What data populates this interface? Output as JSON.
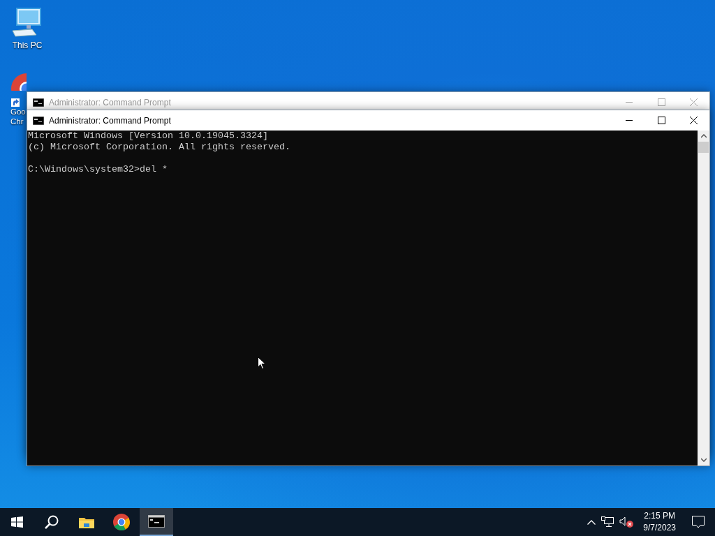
{
  "desktop": {
    "icons": [
      {
        "kind": "computer",
        "label_lines": [
          "This PC"
        ]
      },
      {
        "kind": "chrome",
        "label_lines": [
          "Goo",
          "Chr"
        ]
      }
    ]
  },
  "windows": [
    {
      "title": "Administrator: Command Prompt",
      "active": false
    },
    {
      "title": "Administrator: Command Prompt",
      "active": true,
      "console": {
        "lines": [
          "Microsoft Windows [Version 10.0.19045.3324]",
          "(c) Microsoft Corporation. All rights reserved."
        ],
        "prompt": "C:\\Windows\\system32>del *"
      }
    }
  ],
  "taskbar": {
    "items": [
      {
        "kind": "start",
        "selected": false
      },
      {
        "kind": "search",
        "selected": false
      },
      {
        "kind": "explorer",
        "selected": false
      },
      {
        "kind": "chrome",
        "selected": false
      },
      {
        "kind": "cmd",
        "selected": true
      }
    ],
    "tray": {
      "volume_muted": true,
      "time": "2:15 PM",
      "date": "9/7/2023"
    }
  }
}
